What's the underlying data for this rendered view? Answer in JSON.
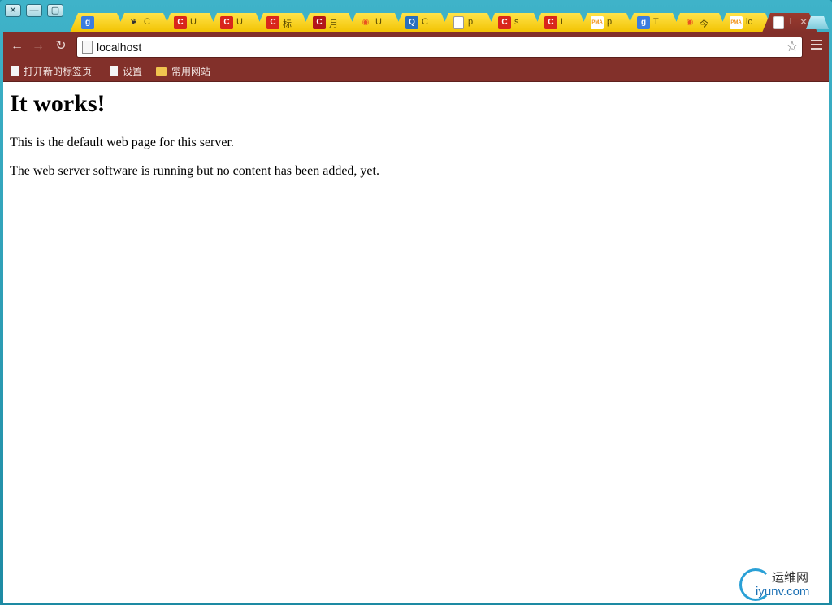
{
  "window": {
    "buttons": [
      "✕",
      "—",
      "▢"
    ]
  },
  "tabs": [
    {
      "icon": "google-icon",
      "icon_text": "g",
      "color": "#3b7de0",
      "text": ""
    },
    {
      "icon": "gnome-icon",
      "icon_text": "❦",
      "color": "#333333",
      "text": "C"
    },
    {
      "icon": "c-logo-icon",
      "icon_text": "C",
      "color": "#d9261c",
      "text": "U"
    },
    {
      "icon": "c-logo-icon",
      "icon_text": "C",
      "color": "#d9261c",
      "text": "U"
    },
    {
      "icon": "c-logo-icon",
      "icon_text": "C",
      "color": "#d9261c",
      "text": "标"
    },
    {
      "icon": "c-logo-icon",
      "icon_text": "C",
      "color": "#b2161a",
      "text": "月"
    },
    {
      "icon": "ubuntu-icon",
      "icon_text": "◉",
      "color": "#e95420",
      "text": "U"
    },
    {
      "icon": "q-icon",
      "icon_text": "Q",
      "color": "#2a6fbd",
      "text": "C"
    },
    {
      "icon": "page-icon",
      "icon_text": "",
      "color": "#ffffff",
      "text": "p"
    },
    {
      "icon": "c-logo-icon",
      "icon_text": "C",
      "color": "#d9261c",
      "text": "s"
    },
    {
      "icon": "c-logo-icon",
      "icon_text": "C",
      "color": "#d9261c",
      "text": "L"
    },
    {
      "icon": "phpmyadmin-icon",
      "icon_text": "PMA",
      "color": "#f29111",
      "text": "p"
    },
    {
      "icon": "google-icon",
      "icon_text": "g",
      "color": "#3b7de0",
      "text": "T"
    },
    {
      "icon": "ubuntu-icon",
      "icon_text": "◉",
      "color": "#e95420",
      "text": "今"
    },
    {
      "icon": "phpmyadmin-icon",
      "icon_text": "PMA",
      "color": "#f29111",
      "text": "lc"
    },
    {
      "icon": "page-icon",
      "icon_text": "",
      "color": "#ffffff",
      "text": "l",
      "active": true
    }
  ],
  "toolbar": {
    "back": "←",
    "forward": "→",
    "reload": "↻",
    "url": "localhost",
    "star": "☆"
  },
  "bookmarks": [
    {
      "label": "打开新的标签页",
      "icon": "page-icon"
    },
    {
      "label": "设置",
      "icon": "page-icon"
    },
    {
      "label": "常用网站",
      "icon": "folder-icon"
    }
  ],
  "page": {
    "heading": "It works!",
    "para1": "This is the default web page for this server.",
    "para2": "The web server software is running but no content has been added, yet."
  },
  "watermark": {
    "line1": "运维网",
    "line2": "iyunv.com"
  }
}
